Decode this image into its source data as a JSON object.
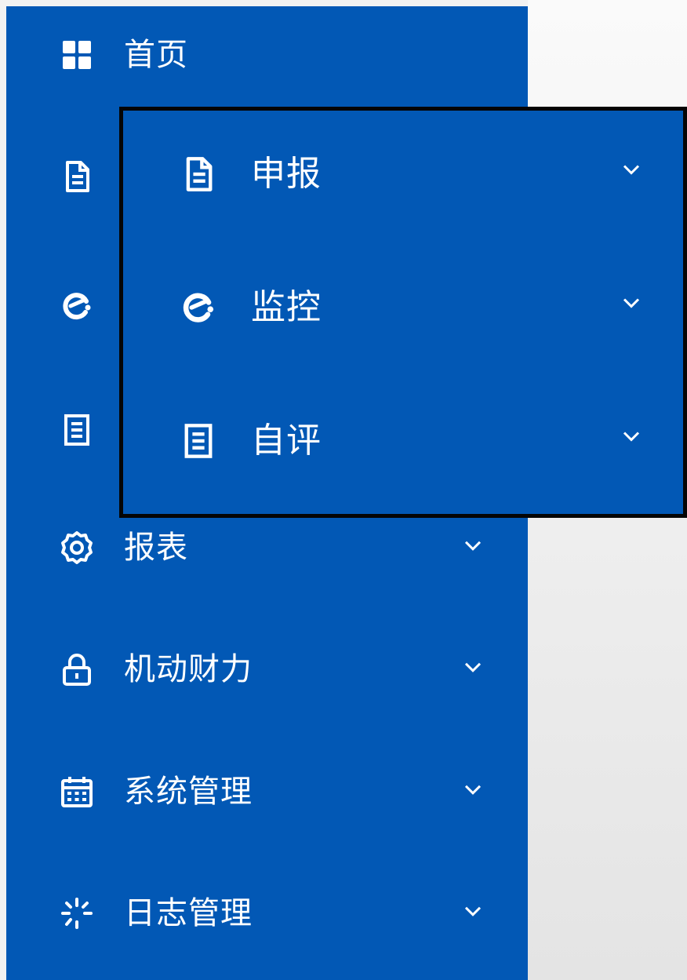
{
  "sidebar": {
    "items": [
      {
        "label": "首页",
        "icon": "grid-icon"
      },
      {
        "label": "",
        "icon": "document-icon"
      },
      {
        "label": "",
        "icon": "monitor-gauge-icon"
      },
      {
        "label": "",
        "icon": "notes-icon"
      },
      {
        "label": "报表",
        "icon": "gear-icon"
      },
      {
        "label": "机动财力",
        "icon": "lock-icon"
      },
      {
        "label": "系统管理",
        "icon": "calendar-icon"
      },
      {
        "label": "日志管理",
        "icon": "loading-icon"
      }
    ]
  },
  "popup": {
    "items": [
      {
        "label": "申报",
        "icon": "document-icon"
      },
      {
        "label": "监控",
        "icon": "monitor-gauge-icon"
      },
      {
        "label": "自评",
        "icon": "notes-icon"
      }
    ]
  },
  "colors": {
    "sidebar_bg": "#0258b5",
    "text": "#ffffff",
    "popup_border": "#050505",
    "content_bg": "#f4f4f4"
  }
}
